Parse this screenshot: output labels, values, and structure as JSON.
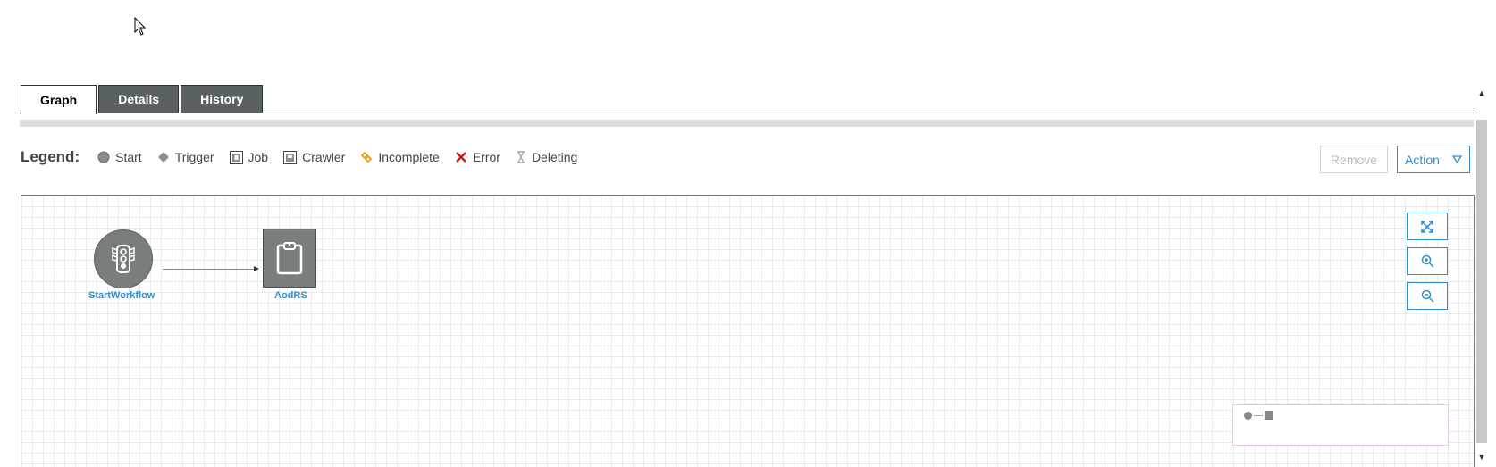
{
  "tabs": [
    {
      "label": "Graph",
      "active": true
    },
    {
      "label": "Details",
      "active": false
    },
    {
      "label": "History",
      "active": false
    }
  ],
  "legend": {
    "title": "Legend:",
    "items": [
      {
        "label": "Start",
        "icon": "circle-icon"
      },
      {
        "label": "Trigger",
        "icon": "diamond-icon"
      },
      {
        "label": "Job",
        "icon": "job-square-icon"
      },
      {
        "label": "Crawler",
        "icon": "crawler-square-icon"
      },
      {
        "label": "Incomplete",
        "icon": "incomplete-icon"
      },
      {
        "label": "Error",
        "icon": "x-icon"
      },
      {
        "label": "Deleting",
        "icon": "hourglass-icon"
      }
    ]
  },
  "toolbar": {
    "remove_label": "Remove",
    "action_label": "Action",
    "remove_disabled": true
  },
  "graph": {
    "nodes": [
      {
        "label": "StartWorkflow",
        "type": "start",
        "icon": "traffic-light-icon"
      },
      {
        "label": "AodRS",
        "type": "job",
        "icon": "clipboard-icon"
      }
    ],
    "edges": [
      {
        "from": "StartWorkflow",
        "to": "AodRS"
      }
    ]
  },
  "zoom_controls": [
    {
      "name": "fit-to-screen",
      "icon": "expand-icon"
    },
    {
      "name": "zoom-in",
      "icon": "zoom-in-icon"
    },
    {
      "name": "zoom-out",
      "icon": "zoom-out-icon"
    }
  ],
  "colors": {
    "accent": "#2f8fca",
    "tab_inactive": "#5a6163",
    "node_fill": "#7a7d7e",
    "error": "#cc1f1f",
    "incomplete": "#e8a317"
  }
}
